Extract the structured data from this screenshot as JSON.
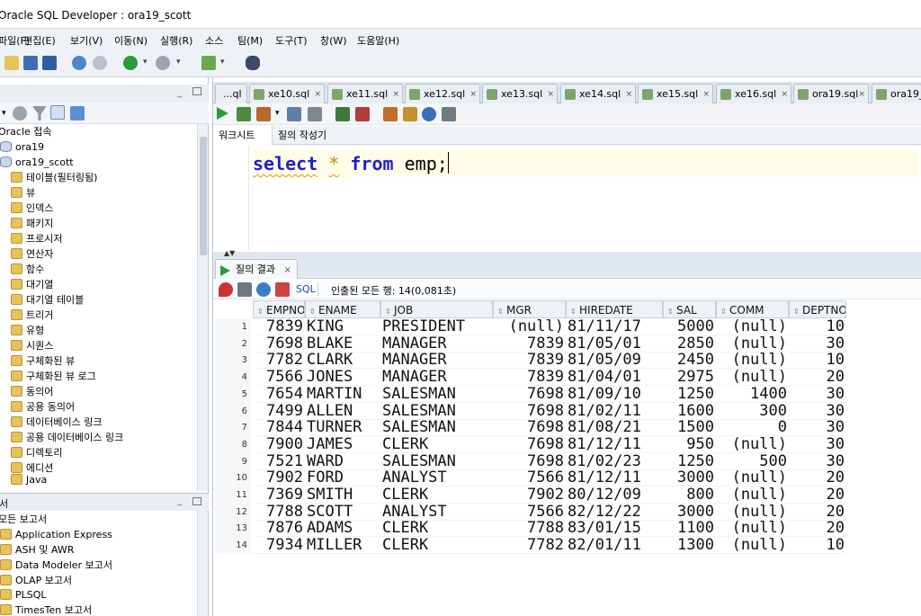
{
  "window": {
    "title": "Oracle SQL Developer : ora19_scott"
  },
  "menu": [
    "파일(F)",
    "편집(E)",
    "보기(V)",
    "이동(N)",
    "실행(R)",
    "소스",
    "팀(M)",
    "도구(T)",
    "창(W)",
    "도움말(H)"
  ],
  "connections": {
    "root_label": "Oracle 접속",
    "items": [
      {
        "label": "ora19",
        "icon": "database-icon"
      },
      {
        "label": "ora19_scott",
        "icon": "database-icon"
      },
      {
        "label": "테이블(필터링됨)",
        "icon": "folder-icon"
      },
      {
        "label": "뷰",
        "icon": "folder-icon"
      },
      {
        "label": "인덱스",
        "icon": "folder-icon"
      },
      {
        "label": "패키지",
        "icon": "folder-icon"
      },
      {
        "label": "프로시저",
        "icon": "folder-icon"
      },
      {
        "label": "연산자",
        "icon": "folder-icon"
      },
      {
        "label": "함수",
        "icon": "folder-icon"
      },
      {
        "label": "대기열",
        "icon": "folder-icon"
      },
      {
        "label": "대기열 테이블",
        "icon": "folder-icon"
      },
      {
        "label": "트리거",
        "icon": "folder-icon"
      },
      {
        "label": "유형",
        "icon": "folder-icon"
      },
      {
        "label": "시퀀스",
        "icon": "folder-icon"
      },
      {
        "label": "구체화된 뷰",
        "icon": "folder-icon"
      },
      {
        "label": "구체화된 뷰 로그",
        "icon": "folder-icon"
      },
      {
        "label": "동의어",
        "icon": "folder-icon"
      },
      {
        "label": "공용 동의어",
        "icon": "folder-icon"
      },
      {
        "label": "데이터베이스 링크",
        "icon": "folder-icon"
      },
      {
        "label": "공용 데이터베이스 링크",
        "icon": "folder-icon"
      },
      {
        "label": "디렉토리",
        "icon": "folder-icon"
      },
      {
        "label": "에디션",
        "icon": "folder-icon"
      },
      {
        "label": "Java",
        "icon": "folder-icon"
      }
    ]
  },
  "reports": {
    "header": "서",
    "root_label": "모든 보고서",
    "items": [
      "Application Express",
      "ASH 및 AWR",
      "Data Modeler 보고서",
      "OLAP 보고서",
      "PLSQL",
      "TimesTen 보고서"
    ]
  },
  "editor_tabs": [
    "...ql",
    "xe10.sql",
    "xe11.sql",
    "xe12.sql",
    "xe13.sql",
    "xe14.sql",
    "xe15.sql",
    "xe16.sql",
    "ora19.sql",
    "ora19_..."
  ],
  "subtabs": [
    "워크시트",
    "질의 작성기"
  ],
  "code": {
    "kw1": "select",
    "star": "*",
    "kw2": "from",
    "rest": "emp;"
  },
  "results": {
    "tab_label": "질의 결과",
    "sql_label": "SQL",
    "status": "인출된 모든 행: 14(0,081초)",
    "columns": [
      "EMPNO",
      "ENAME",
      "JOB",
      "MGR",
      "HIREDATE",
      "SAL",
      "COMM",
      "DEPTNO"
    ],
    "rows": [
      [
        "7839",
        "KING",
        "PRESIDENT",
        "(null)",
        "81/11/17",
        "5000",
        "(null)",
        "10"
      ],
      [
        "7698",
        "BLAKE",
        "MANAGER",
        "7839",
        "81/05/01",
        "2850",
        "(null)",
        "30"
      ],
      [
        "7782",
        "CLARK",
        "MANAGER",
        "7839",
        "81/05/09",
        "2450",
        "(null)",
        "10"
      ],
      [
        "7566",
        "JONES",
        "MANAGER",
        "7839",
        "81/04/01",
        "2975",
        "(null)",
        "20"
      ],
      [
        "7654",
        "MARTIN",
        "SALESMAN",
        "7698",
        "81/09/10",
        "1250",
        "1400",
        "30"
      ],
      [
        "7499",
        "ALLEN",
        "SALESMAN",
        "7698",
        "81/02/11",
        "1600",
        "300",
        "30"
      ],
      [
        "7844",
        "TURNER",
        "SALESMAN",
        "7698",
        "81/08/21",
        "1500",
        "0",
        "30"
      ],
      [
        "7900",
        "JAMES",
        "CLERK",
        "7698",
        "81/12/11",
        "950",
        "(null)",
        "30"
      ],
      [
        "7521",
        "WARD",
        "SALESMAN",
        "7698",
        "81/02/23",
        "1250",
        "500",
        "30"
      ],
      [
        "7902",
        "FORD",
        "ANALYST",
        "7566",
        "81/12/11",
        "3000",
        "(null)",
        "20"
      ],
      [
        "7369",
        "SMITH",
        "CLERK",
        "7902",
        "80/12/09",
        "800",
        "(null)",
        "20"
      ],
      [
        "7788",
        "SCOTT",
        "ANALYST",
        "7566",
        "82/12/22",
        "3000",
        "(null)",
        "20"
      ],
      [
        "7876",
        "ADAMS",
        "CLERK",
        "7788",
        "83/01/15",
        "1100",
        "(null)",
        "20"
      ],
      [
        "7934",
        "MILLER",
        "CLERK",
        "7782",
        "82/01/11",
        "1300",
        "(null)",
        "10"
      ]
    ]
  }
}
